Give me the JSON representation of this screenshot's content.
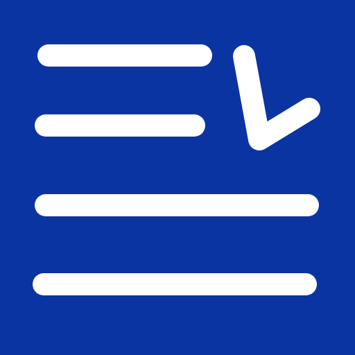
{
  "icon": {
    "name": "list-with-checkmark-icon",
    "lines": 4,
    "has_checkmark": true
  },
  "colors": {
    "background": "#0B34A3",
    "foreground": "#FFFFFF"
  }
}
